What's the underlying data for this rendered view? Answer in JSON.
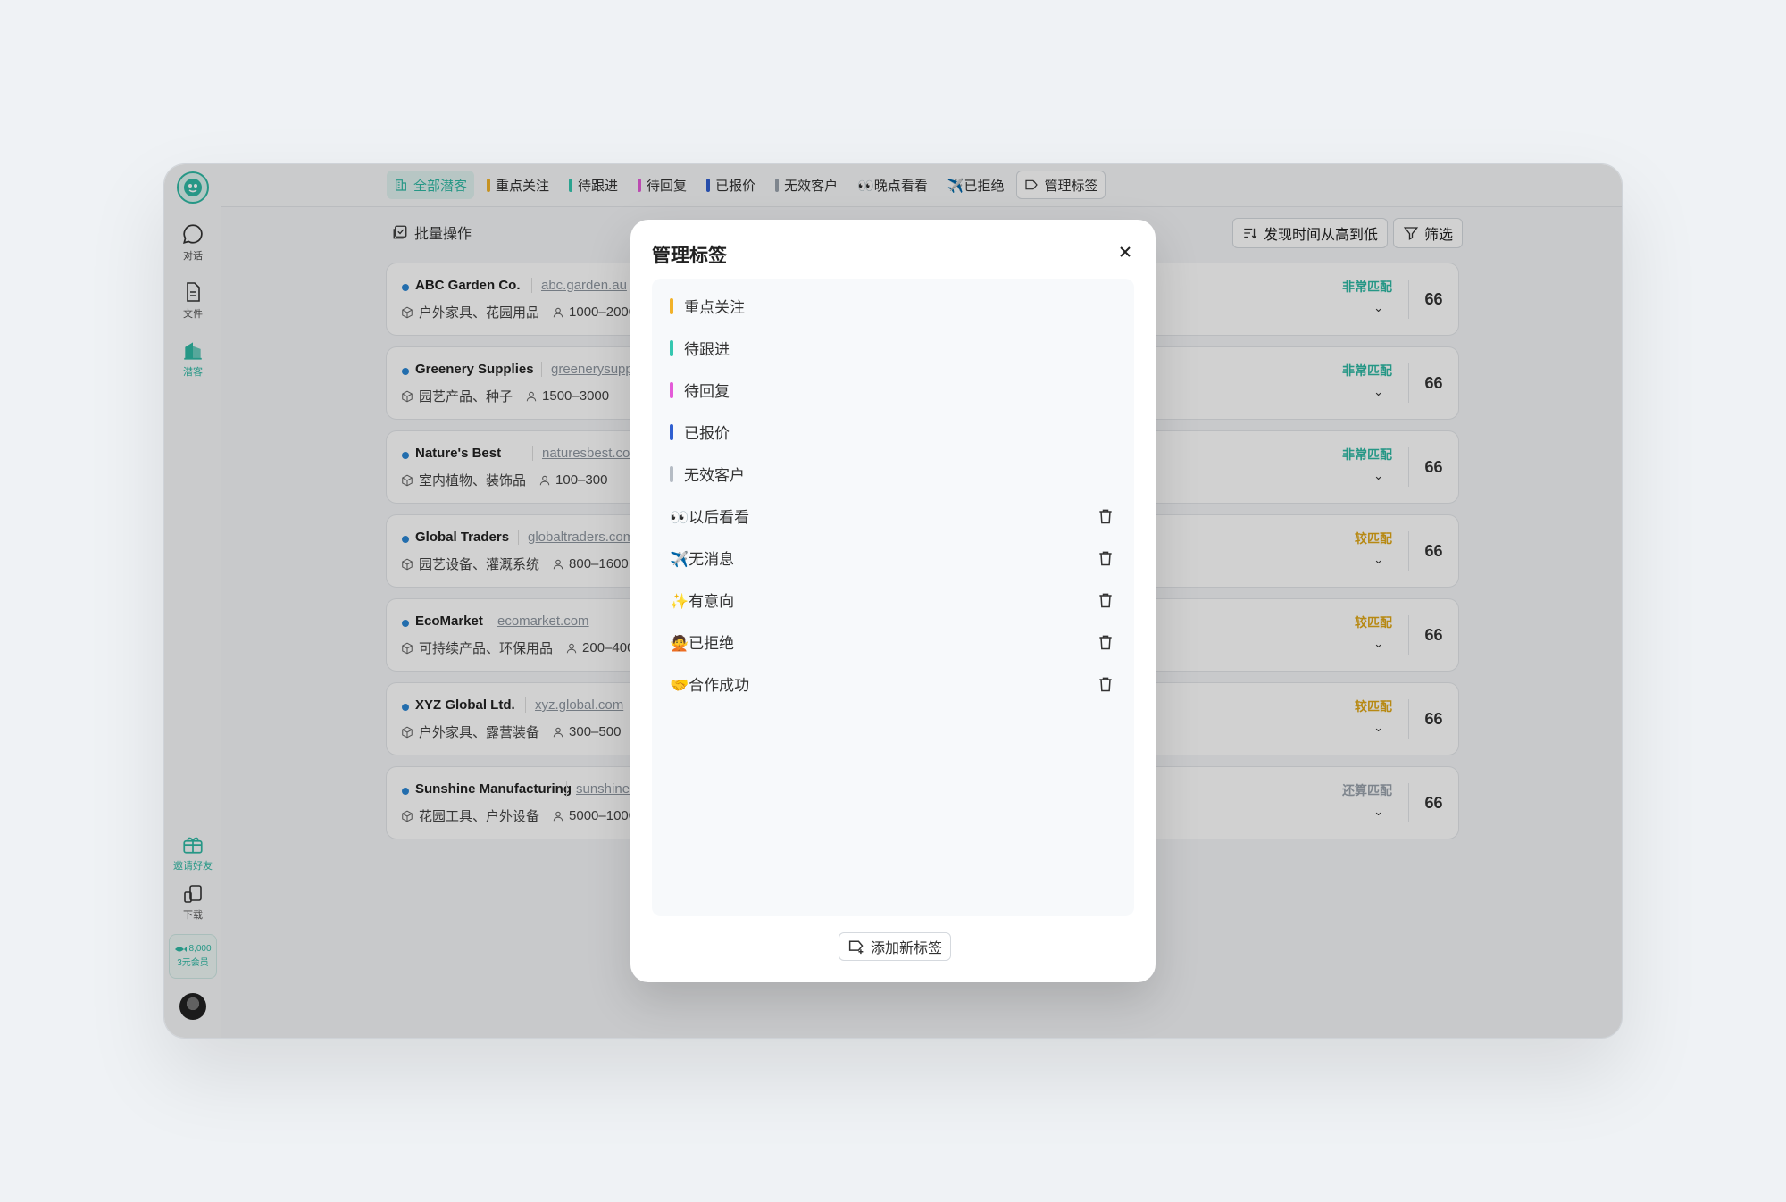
{
  "sidebar": {
    "items": [
      {
        "label": "对话",
        "icon": "chat-icon"
      },
      {
        "label": "文件",
        "icon": "file-icon"
      },
      {
        "label": "潜客",
        "icon": "building-icon"
      }
    ],
    "invite_label": "邀请好友",
    "download_label": "下载",
    "member": {
      "points": "8,000",
      "label": "3元会员"
    }
  },
  "tabs": [
    {
      "label": "全部潜客",
      "active": true
    },
    {
      "label": "重点关注",
      "color": "#f2b22a"
    },
    {
      "label": "待跟进",
      "color": "#35c7b0"
    },
    {
      "label": "待回复",
      "color": "#e45bd8"
    },
    {
      "label": "已报价",
      "color": "#2f5fd0"
    },
    {
      "label": "无效客户",
      "color": "#9aa3ad"
    },
    {
      "label": "👀晚点看看"
    },
    {
      "label": "✈️已拒绝"
    },
    {
      "label": "管理标签"
    }
  ],
  "toolbar": {
    "batch_label": "批量操作",
    "sort_label": "发现时间从高到低",
    "filter_label": "筛选"
  },
  "customers": [
    {
      "name": "ABC Garden Co.",
      "site": "abc.garden.au",
      "products": "户外家具、花园用品",
      "size": "1000–2000",
      "match": "非常匹配",
      "match_color": "#2fb9a4"
    },
    {
      "name": "Greenery Supplies",
      "site": "greenerysupplie",
      "products": "园艺产品、种子",
      "size": "1500–3000",
      "match": "非常匹配",
      "match_color": "#2fb9a4"
    },
    {
      "name": "Nature's Best",
      "site": "naturesbest.com",
      "products": "室内植物、装饰品",
      "size": "100–300",
      "match": "非常匹配",
      "match_color": "#2fb9a4"
    },
    {
      "name": "Global Traders",
      "site": "globaltraders.com",
      "products": "园艺设备、灌溉系统",
      "size": "800–1600",
      "match": "较匹配",
      "match_color": "#e0a818"
    },
    {
      "name": "EcoMarket",
      "site": "ecomarket.com",
      "products": "可持续产品、环保用品",
      "size": "200–400",
      "match": "较匹配",
      "match_color": "#e0a818"
    },
    {
      "name": "XYZ Global Ltd.",
      "site": "xyz.global.com",
      "products": "户外家具、露营装备",
      "size": "300–500",
      "match": "较匹配",
      "match_color": "#e0a818"
    },
    {
      "name": "Sunshine Manufacturing",
      "site": "sunshine",
      "products": "花园工具、户外设备",
      "size": "5000–1000",
      "match": "还算匹配",
      "match_color": "#9aa3ad"
    }
  ],
  "quote_symbol": "66",
  "chevron_symbol": "⌄",
  "modal": {
    "title": "管理标签",
    "close_symbol": "×",
    "tags": [
      {
        "label": "重点关注",
        "color": "#f2b22a",
        "deletable": false
      },
      {
        "label": "待跟进",
        "color": "#35c7b0",
        "deletable": false
      },
      {
        "label": "待回复",
        "color": "#e45bd8",
        "deletable": false
      },
      {
        "label": "已报价",
        "color": "#2f5fd0",
        "deletable": false
      },
      {
        "label": "无效客户",
        "color": "#b5bcc4",
        "deletable": false
      },
      {
        "label": "👀以后看看",
        "deletable": true
      },
      {
        "label": "✈️无消息",
        "deletable": true
      },
      {
        "label": "✨有意向",
        "deletable": true
      },
      {
        "label": "🙅已拒绝",
        "deletable": true
      },
      {
        "label": "🤝合作成功",
        "deletable": true
      }
    ],
    "add_label": "添加新标签"
  },
  "colors": {
    "accent": "#2fb9a4"
  }
}
